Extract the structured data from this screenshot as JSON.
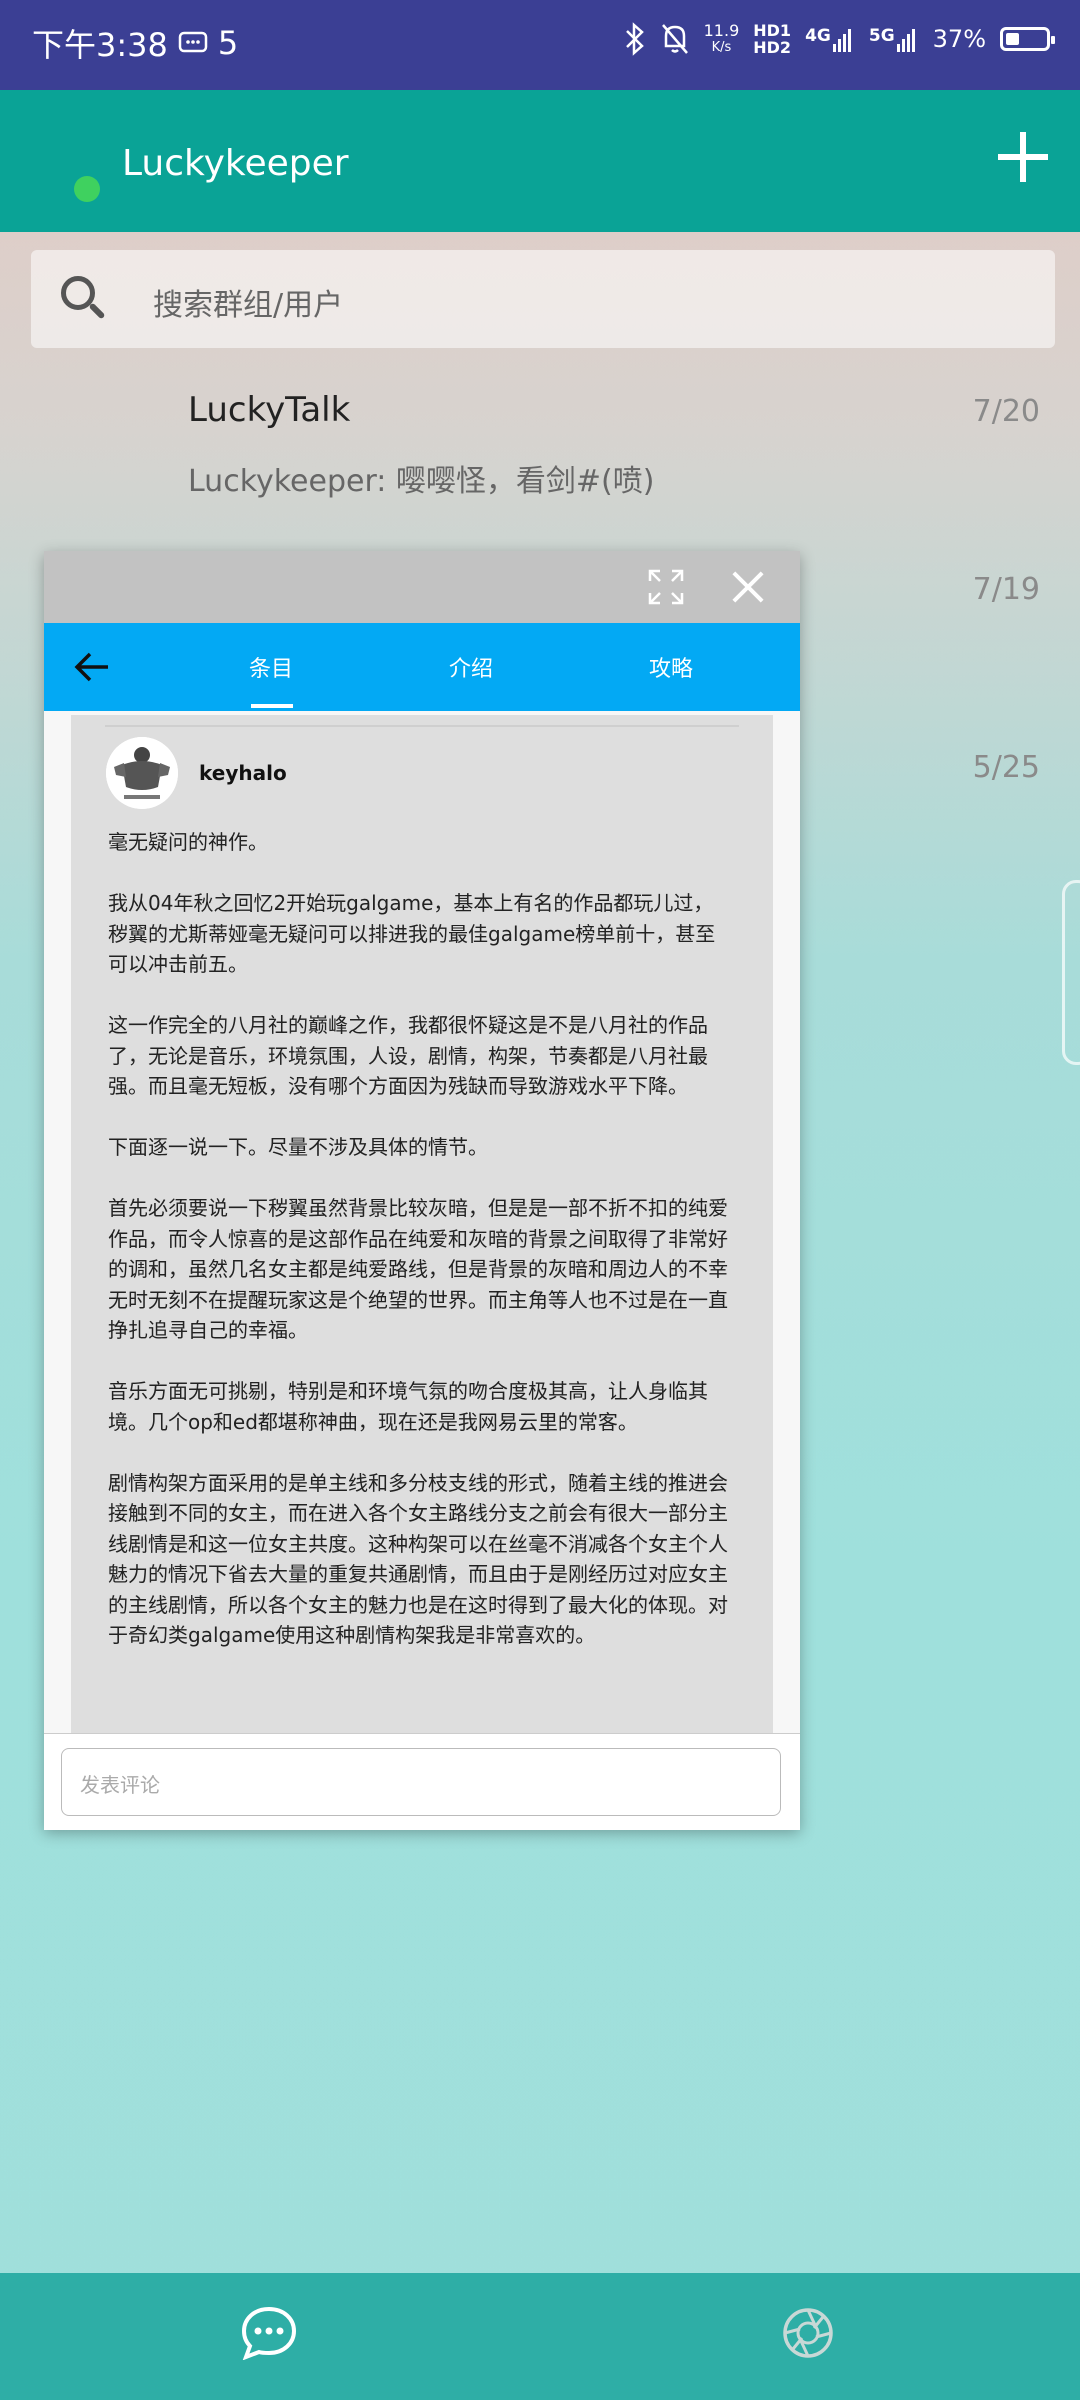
{
  "status_bar": {
    "time": "下午3:38",
    "notification_count": "5",
    "net_speed_value": "11.9",
    "net_speed_unit": "K/s",
    "hd1": "HD1",
    "hd2": "HD2",
    "net_4g": "4G",
    "net_5g": "5G",
    "battery": "37%"
  },
  "app_bar": {
    "title": "Luckykeeper"
  },
  "search": {
    "placeholder": "搜索群组/用户"
  },
  "chats": [
    {
      "name": "LuckyTalk",
      "preview": "Luckykeeper: 嘤嘤怪，看剑#(喷)",
      "date": "7/20"
    },
    {
      "name": "",
      "preview": "",
      "date": "7/19"
    },
    {
      "name": "",
      "preview": "",
      "date": "5/25"
    }
  ],
  "popup": {
    "tabs": [
      "条目",
      "介绍",
      "攻略"
    ],
    "active_tab": "条目",
    "review": {
      "username": "keyhalo",
      "paragraphs": [
        "毫无疑问的神作。",
        "我从04年秋之回忆2开始玩galgame，基本上有名的作品都玩儿过，秽翼的尤斯蒂娅毫无疑问可以排进我的最佳galgame榜单前十，甚至可以冲击前五。",
        "这一作完全的八月社的巅峰之作，我都很怀疑这是不是八月社的作品了，无论是音乐，环境氛围，人设，剧情，构架，节奏都是八月社最强。而且毫无短板，没有哪个方面因为残缺而导致游戏水平下降。",
        "下面逐一说一下。尽量不涉及具体的情节。",
        "首先必须要说一下秽翼虽然背景比较灰暗，但是是一部不折不扣的纯爱作品，而令人惊喜的是这部作品在纯爱和灰暗的背景之间取得了非常好的调和，虽然几名女主都是纯爱路线，但是背景的灰暗和周边人的不幸无时无刻不在提醒玩家这是个绝望的世界。而主角等人也不过是在一直挣扎追寻自己的幸福。",
        "音乐方面无可挑剔，特别是和环境气氛的吻合度极其高，让人身临其境。几个op和ed都堪称神曲，现在还是我网易云里的常客。",
        "剧情构架方面采用的是单主线和多分枝支线的形式，随着主线的推进会接触到不同的女主，而在进入各个女主路线分支之前会有很大一部分主线剧情是和这一位女主共度。这种构架可以在丝毫不消减各个女主个人魅力的情况下省去大量的重复共通剧情，而且由于是刚经历过对应女主的主线剧情，所以各个女主的魅力也是在这时得到了最大化的体现。对于奇幻类galgame使用这种剧情构架我是非常喜欢的。"
      ]
    },
    "comment_placeholder": "发表评论"
  },
  "bottom_nav": {
    "items": [
      "chat-bubble-icon",
      "shutter-icon"
    ]
  },
  "colors": {
    "status_bar": "#3b3f94",
    "app_bar": "#0aa396",
    "popup_nav": "#03a9f4",
    "bottom_nav": "#2eaea6",
    "online": "#3fd15f"
  }
}
